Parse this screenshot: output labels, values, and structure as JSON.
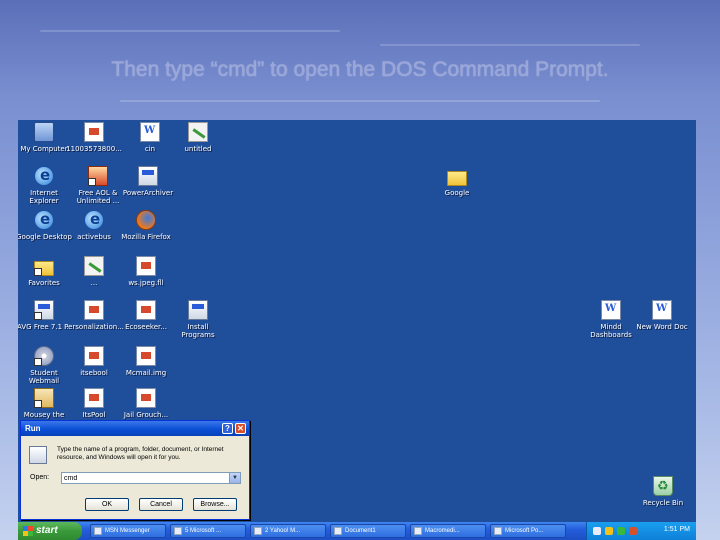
{
  "slide": {
    "title": "Then type “cmd” to open the DOS Command Prompt."
  },
  "desktop": {
    "icons": [
      {
        "label": "My Computer",
        "icon": "computer-icon"
      },
      {
        "label": "11003573800...",
        "icon": "document-icon"
      },
      {
        "label": "cin",
        "icon": "word-document-icon"
      },
      {
        "label": "untitled",
        "icon": "paint-icon"
      },
      {
        "label": "Internet\nExplorer",
        "icon": "internet-explorer-icon"
      },
      {
        "label": "Free AOL &\nUnlimited ...",
        "icon": "aol-icon"
      },
      {
        "label": "PowerArchiver",
        "icon": "archiver-icon"
      },
      {
        "label": "Google",
        "icon": "folder-icon"
      },
      {
        "label": "Google Desktop",
        "icon": "google-desktop-icon"
      },
      {
        "label": "activebus",
        "icon": "activebus-icon"
      },
      {
        "label": "Mozilla Firefox",
        "icon": "firefox-icon"
      },
      {
        "label": "Favorites",
        "icon": "favorites-folder-icon"
      },
      {
        "label": "...",
        "icon": "paint-icon"
      },
      {
        "label": "ws.jpeg.fll",
        "icon": "image-file-icon"
      },
      {
        "label": "AVG Free 7.1 ...",
        "icon": "avg-antivirus-icon"
      },
      {
        "label": "Personalization...",
        "icon": "document-icon"
      },
      {
        "label": "Ecoseeker...",
        "icon": "document-icon"
      },
      {
        "label": "Install\nPrograms",
        "icon": "install-programs-icon"
      },
      {
        "label": "Mindd\nDashboards",
        "icon": "word-document-icon"
      },
      {
        "label": "New Word Doc",
        "icon": "word-document-icon"
      },
      {
        "label": "Student\nWebmail",
        "icon": "webmail-icon"
      },
      {
        "label": "itsebool",
        "icon": "text-file-icon"
      },
      {
        "label": "Mcmail.img",
        "icon": "image-file-icon"
      },
      {
        "label": "Mousey the\n...",
        "icon": "user-icon"
      },
      {
        "label": "ItsPool",
        "icon": "text-file-icon"
      },
      {
        "label": "Jail Grouch...",
        "icon": "image-file-icon"
      },
      {
        "label": "Recycle Bin",
        "icon": "recycle-bin-icon"
      }
    ]
  },
  "run_dialog": {
    "title": "Run",
    "help_glyph": "?",
    "close_glyph": "✕",
    "description": "Type the name of a program, folder, document, or Internet resource, and Windows will open it for you.",
    "open_label": "Open:",
    "open_value": "cmd",
    "dropdown_glyph": "▼",
    "ok_label": "OK",
    "cancel_label": "Cancel",
    "browse_label": "Browse..."
  },
  "taskbar": {
    "start_label": "start",
    "items": [
      {
        "label": "MSN Messenger"
      },
      {
        "label": "5 Microsoft ..."
      },
      {
        "label": "2 Yahoo! M..."
      },
      {
        "label": "Document1"
      },
      {
        "label": "Macromedi..."
      },
      {
        "label": "Microsoft Po..."
      }
    ],
    "clock": "1:51 PM"
  }
}
